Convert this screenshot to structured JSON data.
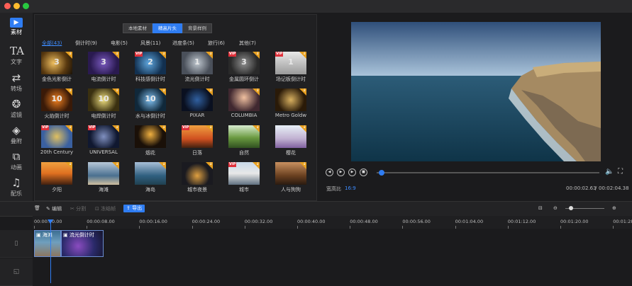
{
  "window": {
    "traffic_lights": [
      "#ff5f57",
      "#febc2e",
      "#28c840"
    ]
  },
  "sidebar": {
    "items": [
      {
        "label": "素材",
        "icon": "play-icon",
        "active": true
      },
      {
        "label": "文字",
        "icon": "text-icon"
      },
      {
        "label": "转场",
        "icon": "transition-icon"
      },
      {
        "label": "滤镜",
        "icon": "filter-icon"
      },
      {
        "label": "叠附",
        "icon": "layers-icon"
      },
      {
        "label": "动画",
        "icon": "animation-icon"
      },
      {
        "label": "配乐",
        "icon": "music-icon"
      }
    ]
  },
  "library": {
    "tabs": [
      "本地素材",
      "精高片头",
      "背景样例"
    ],
    "active_tab": 1,
    "categories": [
      "全部(43)",
      "倒计时(9)",
      "电影(5)",
      "风景(11)",
      "进度条(5)",
      "旅行(6)",
      "其他(7)"
    ],
    "items": [
      {
        "caption": "金色光影倒计",
        "mark": "3"
      },
      {
        "caption": "电流倒计时",
        "mark": "3"
      },
      {
        "caption": "科技感倒计时",
        "mark": "2",
        "vip": true
      },
      {
        "caption": "流光倒计时",
        "mark": "1"
      },
      {
        "caption": "金属圆环倒计",
        "mark": "3",
        "vip": true
      },
      {
        "caption": "场记板倒计时",
        "mark": "1",
        "vip": true
      },
      {
        "caption": "火焰倒计时",
        "mark": "10"
      },
      {
        "caption": "电焊倒计时",
        "mark": "10"
      },
      {
        "caption": "水与冰倒计时",
        "mark": "10"
      },
      {
        "caption": "PIXAR",
        "mark": ""
      },
      {
        "caption": "COLUMBIA",
        "mark": ""
      },
      {
        "caption": "Metro Goldw",
        "mark": ""
      },
      {
        "caption": "20th Century",
        "mark": "",
        "vip": true
      },
      {
        "caption": "UNIVERSAL",
        "mark": "",
        "vip": true
      },
      {
        "caption": "烟花",
        "mark": ""
      },
      {
        "caption": "日落",
        "mark": "",
        "vip": true
      },
      {
        "caption": "自然",
        "mark": ""
      },
      {
        "caption": "樱花",
        "mark": ""
      },
      {
        "caption": "夕阳",
        "mark": ""
      },
      {
        "caption": "海滩",
        "mark": ""
      },
      {
        "caption": "海岛",
        "mark": ""
      },
      {
        "caption": "城市夜景",
        "mark": ""
      },
      {
        "caption": "城市",
        "mark": "",
        "vip": true
      },
      {
        "caption": "人与狗狗",
        "mark": ""
      }
    ],
    "vip_label": "VIP"
  },
  "player": {
    "aspect_label": "宽高比",
    "aspect_value": "16:9",
    "current_time": "00:00:02.63",
    "total_time": "00:02:04.38",
    "progress_fraction": 0.02
  },
  "toolbar": {
    "edit": "编辑",
    "split": "分割",
    "freeze": "冻结帧",
    "export": "导出"
  },
  "timeline": {
    "ruler": [
      "00:00:00.00",
      "00:00:08.00",
      "00:00:16.00",
      "00:00:24.00",
      "00:00:32.00",
      "00:00:40.00",
      "00:00:48.00",
      "00:00:56.00",
      "00:01:04.00",
      "00:01:12.00",
      "00:01:20.00",
      "00:01:28"
    ],
    "clips": [
      {
        "label": "海滩"
      },
      {
        "label": "流光倒计时"
      }
    ]
  },
  "colors": {
    "accent": "#2f7df3",
    "vip": "#e0303a",
    "download_badge": "#e8a020"
  }
}
